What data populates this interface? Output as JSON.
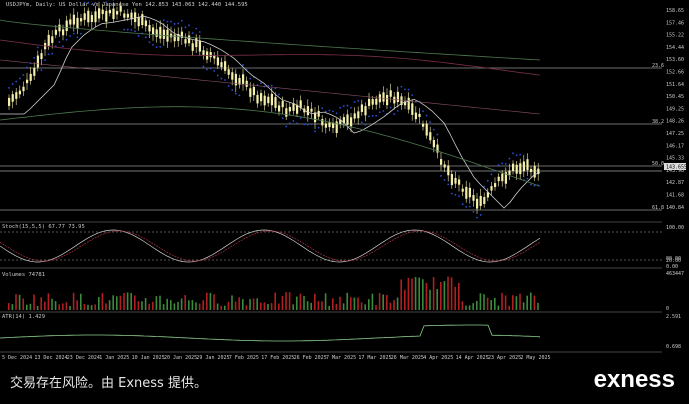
{
  "chart": {
    "header": "USDJPYm, Daily: US Dollar vs Japanese Yen 142.853 143.063 142.440 144.595",
    "stoch_label": "Stoch(15,5,5) 67.77 73.95",
    "volumes_label": "Volumes 74781",
    "atr_label": "ATR(14) 1.429",
    "price_ticks": [
      "158.65",
      "157.46",
      "155.22",
      "154.44",
      "153.60",
      "152.66",
      "151.64",
      "150.45",
      "149.25",
      "148.26",
      "147.25",
      "146.17",
      "145.33",
      "143.98",
      "142.87",
      "141.68",
      "140.84"
    ],
    "current_price_tag": "143.655",
    "fib_labels": [
      "23.6",
      "38.2",
      "50.0",
      "61.8"
    ],
    "stoch_ticks": [
      "100.00",
      "80.00",
      "20.00",
      "0.00"
    ],
    "volume_ticks": [
      "463447",
      "0"
    ],
    "atr_ticks": [
      "2.591",
      "0.698"
    ],
    "date_ticks": [
      "5 Dec 2024",
      "13 Dec 2024",
      "23 Dec 2024",
      "1 Jan 2025",
      "10 Jan 2025",
      "20 Jan 2025",
      "29 Jan 2025",
      "7 Feb 2025",
      "17 Feb 2025",
      "26 Feb 2025",
      "7 Mar 2025",
      "17 Mar 2025",
      "26 Mar 2025",
      "4 Apr 2025",
      "14 Apr 2025",
      "23 Apr 2025",
      "2 May 2025"
    ]
  },
  "colors": {
    "bg": "#000000",
    "candle": "#f4f0a8",
    "grid": "#d8d8d8",
    "sar": "#2a4fd8",
    "ma_green": "#4f7a4f",
    "ma_maroon": "#7a2f4a",
    "volume_up": "#3c8a3c",
    "volume_down": "#b02020"
  },
  "footer": {
    "disclaimer": "交易存在风险。由 Exness 提供。",
    "brand": "exness"
  }
}
